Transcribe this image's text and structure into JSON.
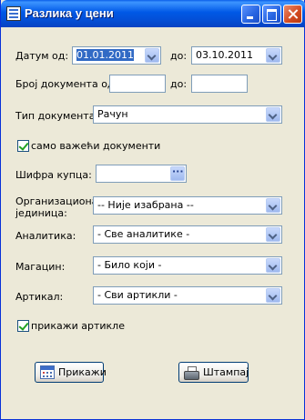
{
  "window": {
    "title": "Разлика у цени"
  },
  "date_from": {
    "label": "Датум од:",
    "value": "01.01.2011"
  },
  "date_to": {
    "label": "до:",
    "value": "03.10.2011"
  },
  "doc_number_from": {
    "label": "Број документа од:",
    "value": ""
  },
  "doc_number_to": {
    "label": "до:",
    "value": ""
  },
  "doc_type": {
    "label": "Тип документа:",
    "value": "Рачун"
  },
  "only_valid": {
    "label": "само важећи документи",
    "checked": true
  },
  "buyer_code": {
    "label": "Шифра купца:",
    "value": ""
  },
  "org_unit": {
    "label_line1": "Организациона",
    "label_line2": "јединица:",
    "value": "-- Није изабрана --"
  },
  "analytics": {
    "label": "Аналитика:",
    "value": "- Све аналитике -"
  },
  "warehouse": {
    "label": "Магацин:",
    "value": "- Било који -"
  },
  "article": {
    "label": "Артикал:",
    "value": "- Сви артикли -"
  },
  "show_articles": {
    "label": "прикажи артикле",
    "checked": true
  },
  "buttons": {
    "show": "Прикажи",
    "print": "Штампај"
  },
  "icons": {
    "window": "window-icon",
    "show": "calendar-icon",
    "print": "printer-icon"
  }
}
